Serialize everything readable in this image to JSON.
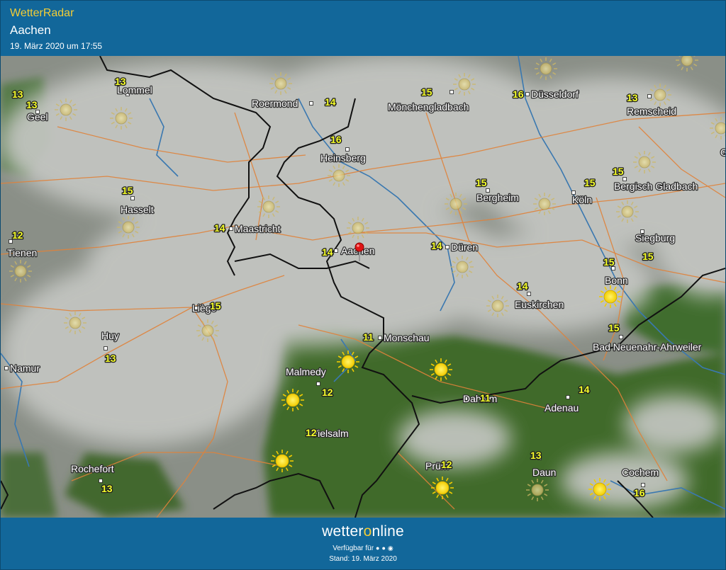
{
  "header": {
    "app_title": "WetterRadar",
    "location": "Aachen",
    "timestamp": "19. März 2020 um 17:55"
  },
  "footer": {
    "brand_prefix": "wetter",
    "brand_accent": "o",
    "brand_suffix": "nline",
    "available": "Verfügbar für",
    "stand": "Stand: 19. März 2020"
  },
  "colors": {
    "header_bg": "#12679a",
    "title_accent": "#f3cd36",
    "temperature_text": "#f6ff2a",
    "terrain_green": "#3f6a2c",
    "cloud_grey": "#c3c5c1",
    "river_blue": "#3a78b0",
    "road_orange": "#e0823a",
    "border_black": "#111111",
    "location_pin": "#e01515"
  },
  "map": {
    "marker": "Aachen",
    "cities": [
      {
        "name": "Lommel"
      },
      {
        "name": "Geel"
      },
      {
        "name": "Roermond"
      },
      {
        "name": "Mönchengladbach"
      },
      {
        "name": "Düsseldorf"
      },
      {
        "name": "Remscheid"
      },
      {
        "name": "Heinsberg"
      },
      {
        "name": "Hasselt"
      },
      {
        "name": "Bergheim"
      },
      {
        "name": "Köln"
      },
      {
        "name": "Bergisch Gladbach"
      },
      {
        "name": "Maastricht"
      },
      {
        "name": "Tienen"
      },
      {
        "name": "Aachen"
      },
      {
        "name": "Düren"
      },
      {
        "name": "Siegburg"
      },
      {
        "name": "Bonn"
      },
      {
        "name": "Liège"
      },
      {
        "name": "Euskirchen"
      },
      {
        "name": "Huy"
      },
      {
        "name": "Monschau"
      },
      {
        "name": "Bad Neuenahr-Ahrweiler"
      },
      {
        "name": "Namur"
      },
      {
        "name": "Malmedy"
      },
      {
        "name": "Dahlem"
      },
      {
        "name": "Adenau"
      },
      {
        "name": "Vielsalm"
      },
      {
        "name": "Prüm"
      },
      {
        "name": "Rochefort"
      },
      {
        "name": "Daun"
      },
      {
        "name": "Cochem"
      },
      {
        "name": "G"
      }
    ],
    "temperatures": [
      {
        "value": "13"
      },
      {
        "value": "13"
      },
      {
        "value": "14"
      },
      {
        "value": "15"
      },
      {
        "value": "16"
      },
      {
        "value": "13"
      },
      {
        "value": "16"
      },
      {
        "value": "15"
      },
      {
        "value": "15"
      },
      {
        "value": "15"
      },
      {
        "value": "15"
      },
      {
        "value": "14"
      },
      {
        "value": "12"
      },
      {
        "value": "14"
      },
      {
        "value": "14"
      },
      {
        "value": "15"
      },
      {
        "value": "15"
      },
      {
        "value": "15"
      },
      {
        "value": "14"
      },
      {
        "value": "13"
      },
      {
        "value": "11"
      },
      {
        "value": "15"
      },
      {
        "value": "12"
      },
      {
        "value": "11"
      },
      {
        "value": "14"
      },
      {
        "value": "12"
      },
      {
        "value": "12"
      },
      {
        "value": "13"
      },
      {
        "value": "13"
      },
      {
        "value": "13"
      },
      {
        "value": "16"
      }
    ],
    "weather_icons": [
      {
        "icon": "sun-icon",
        "state": "cloud-dimmed"
      },
      {
        "icon": "sun-icon",
        "state": "cloud-dimmed"
      },
      {
        "icon": "sun-icon",
        "state": "cloud-dimmed"
      },
      {
        "icon": "sun-icon",
        "state": "cloud-dimmed"
      },
      {
        "icon": "sun-icon",
        "state": "cloud-dimmed"
      },
      {
        "icon": "sun-icon",
        "state": "cloud-dimmed"
      },
      {
        "icon": "sun-icon",
        "state": "cloud-dimmed"
      },
      {
        "icon": "sun-icon",
        "state": "cloud-dimmed"
      },
      {
        "icon": "sun-icon",
        "state": "cloud-dimmed"
      },
      {
        "icon": "sun-icon",
        "state": "cloud-dimmed"
      },
      {
        "icon": "sun-icon",
        "state": "cloud-dimmed"
      },
      {
        "icon": "sun-icon",
        "state": "cloud-dimmed"
      },
      {
        "icon": "sun-icon",
        "state": "cloud-dimmed"
      },
      {
        "icon": "sun-icon",
        "state": "cloud-dimmed"
      },
      {
        "icon": "sun-icon",
        "state": "cloud-dimmed"
      },
      {
        "icon": "sun-icon",
        "state": "cloud-dimmed"
      },
      {
        "icon": "sun-icon",
        "state": "cloud-dimmed"
      },
      {
        "icon": "sun-icon",
        "state": "cloud-dimmed"
      },
      {
        "icon": "sun-icon",
        "state": "cloud-dimmed"
      },
      {
        "icon": "sun-icon",
        "state": "cloud-dimmed"
      },
      {
        "icon": "sun-icon",
        "state": "cloud-dimmed"
      },
      {
        "icon": "sun-icon",
        "state": "cloud-dimmed"
      },
      {
        "icon": "sun-icon",
        "state": "clear"
      },
      {
        "icon": "sun-icon",
        "state": "clear"
      },
      {
        "icon": "sun-icon",
        "state": "clear"
      },
      {
        "icon": "sun-icon",
        "state": "clear"
      },
      {
        "icon": "sun-icon",
        "state": "clear"
      },
      {
        "icon": "sun-icon",
        "state": "clear"
      },
      {
        "icon": "sun-icon",
        "state": "clear"
      }
    ]
  }
}
